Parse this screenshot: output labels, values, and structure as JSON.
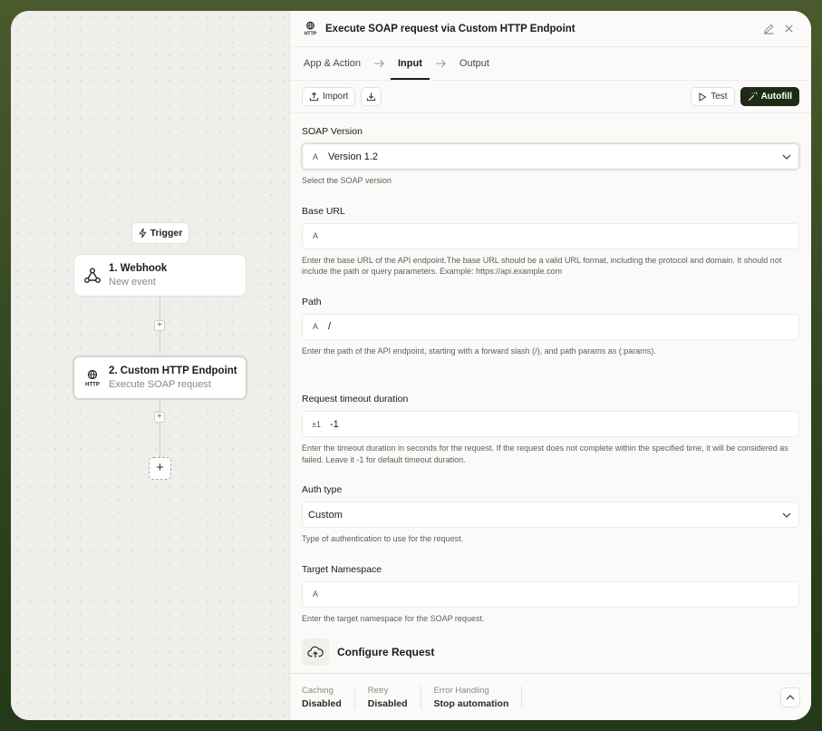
{
  "canvas": {
    "trigger_label": "Trigger",
    "nodes": [
      {
        "title": "1. Webhook",
        "subtitle": "New event",
        "icon": "webhook-icon"
      },
      {
        "title": "2. Custom HTTP Endpoint",
        "subtitle": "Execute SOAP request",
        "icon": "http-icon"
      }
    ],
    "plus": "+",
    "plus_small": "+"
  },
  "panel": {
    "title": "Execute SOAP request via Custom HTTP Endpoint",
    "http_badge": "HTTP",
    "tabs": [
      "App & Action",
      "Input",
      "Output"
    ],
    "active_tab": "Input",
    "toolbar": {
      "import": "Import",
      "test": "Test",
      "autofill": "Autofill"
    }
  },
  "form": {
    "soap_version": {
      "label": "SOAP Version",
      "value": "Version 1.2",
      "help": "Select the SOAP version"
    },
    "base_url": {
      "label": "Base URL",
      "value": "",
      "help": "Enter the base URL of the API endpoint.The base URL should be a valid URL format, including the protocol and domain. It should not include the path or query parameters. Example: https://api.example.com"
    },
    "path": {
      "label": "Path",
      "value": "/",
      "help": "Enter the path of the API endpoint, starting with a forward slash (/), and path params as (:params)."
    },
    "timeout": {
      "label": "Request timeout duration",
      "icon_text": "±1",
      "value": "-1",
      "help": "Enter the timeout duration in seconds for the request. If the request does not complete within the specified time, it will be considered as failed. Leave it -1 for default timeout duration."
    },
    "auth_type": {
      "label": "Auth type",
      "value": "Custom",
      "help": "Type of authentication to use for the request."
    },
    "namespace": {
      "label": "Target Namespace",
      "value": "",
      "help": "Enter the target namespace for the SOAP request."
    },
    "text_icon": "A",
    "configure_label": "Configure Request"
  },
  "footer": {
    "caching": {
      "caption": "Caching",
      "value": "Disabled"
    },
    "retry": {
      "caption": "Retry",
      "value": "Disabled"
    },
    "error": {
      "caption": "Error Handling",
      "value": "Stop automation"
    }
  }
}
